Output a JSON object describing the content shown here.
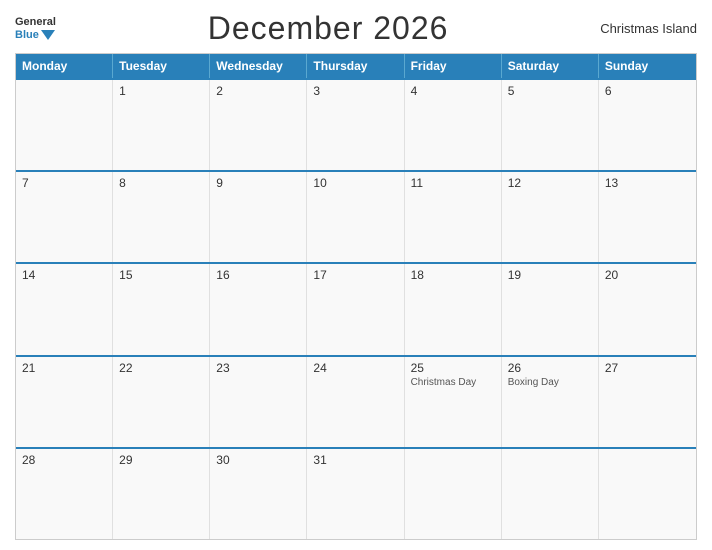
{
  "header": {
    "logo_general": "General",
    "logo_blue": "Blue",
    "title": "December 2026",
    "region": "Christmas Island"
  },
  "days_of_week": [
    "Monday",
    "Tuesday",
    "Wednesday",
    "Thursday",
    "Friday",
    "Saturday",
    "Sunday"
  ],
  "weeks": [
    [
      {
        "day": "",
        "holiday": ""
      },
      {
        "day": "1",
        "holiday": ""
      },
      {
        "day": "2",
        "holiday": ""
      },
      {
        "day": "3",
        "holiday": ""
      },
      {
        "day": "4",
        "holiday": ""
      },
      {
        "day": "5",
        "holiday": ""
      },
      {
        "day": "6",
        "holiday": ""
      }
    ],
    [
      {
        "day": "7",
        "holiday": ""
      },
      {
        "day": "8",
        "holiday": ""
      },
      {
        "day": "9",
        "holiday": ""
      },
      {
        "day": "10",
        "holiday": ""
      },
      {
        "day": "11",
        "holiday": ""
      },
      {
        "day": "12",
        "holiday": ""
      },
      {
        "day": "13",
        "holiday": ""
      }
    ],
    [
      {
        "day": "14",
        "holiday": ""
      },
      {
        "day": "15",
        "holiday": ""
      },
      {
        "day": "16",
        "holiday": ""
      },
      {
        "day": "17",
        "holiday": ""
      },
      {
        "day": "18",
        "holiday": ""
      },
      {
        "day": "19",
        "holiday": ""
      },
      {
        "day": "20",
        "holiday": ""
      }
    ],
    [
      {
        "day": "21",
        "holiday": ""
      },
      {
        "day": "22",
        "holiday": ""
      },
      {
        "day": "23",
        "holiday": ""
      },
      {
        "day": "24",
        "holiday": ""
      },
      {
        "day": "25",
        "holiday": "Christmas Day"
      },
      {
        "day": "26",
        "holiday": "Boxing Day"
      },
      {
        "day": "27",
        "holiday": ""
      }
    ],
    [
      {
        "day": "28",
        "holiday": ""
      },
      {
        "day": "29",
        "holiday": ""
      },
      {
        "day": "30",
        "holiday": ""
      },
      {
        "day": "31",
        "holiday": ""
      },
      {
        "day": "",
        "holiday": ""
      },
      {
        "day": "",
        "holiday": ""
      },
      {
        "day": "",
        "holiday": ""
      }
    ]
  ]
}
